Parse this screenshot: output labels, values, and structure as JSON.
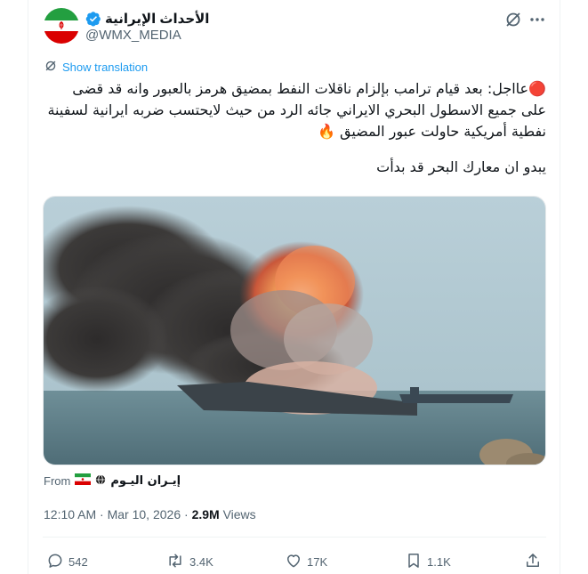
{
  "author": {
    "display_name": "الأحداث الإيرانية",
    "handle": "@WMX_MEDIA",
    "avatar_icon": "iran-flag-avatar",
    "verified_icon": "verified-badge-icon"
  },
  "header_icons": {
    "grok": "grok-icon",
    "more": "more-options-icon"
  },
  "show_translation": "Show translation",
  "tweet": {
    "paragraph_1_line_1": "🔴عااجل: بعد قيام ترامب بإلزام ناقلات النفط بمضيق هرمز  بالعبور وانه قد قضى",
    "paragraph_1_line_2": "على جميع الاسطول البحري الايراني جائه الرد من حيث لايحتسب ضربه ايرانية لسفينة",
    "paragraph_1_line_3": "نفطية أمريكية حاولت عبور المضيق 🔥",
    "paragraph_2": "يبدو ان معارك البحر قد بدأت"
  },
  "media": {
    "type": "image",
    "icon": "ship-explosion-image"
  },
  "from": {
    "label": "From",
    "source": "إيـران اليـوم",
    "flag_icon": "iran-flag-icon",
    "globe_icon": "globe-icon"
  },
  "meta": {
    "time": "12:10 AM",
    "separator": "·",
    "date": "Mar 10, 2026",
    "views_count": "2.9M",
    "views_label": "Views"
  },
  "actions": {
    "replies": "542",
    "reposts": "3.4K",
    "likes": "17K",
    "bookmarks": "1.1K"
  },
  "colors": {
    "accent": "#1d9bf0",
    "secondary_text": "#536471",
    "primary_text": "#0f1419"
  }
}
